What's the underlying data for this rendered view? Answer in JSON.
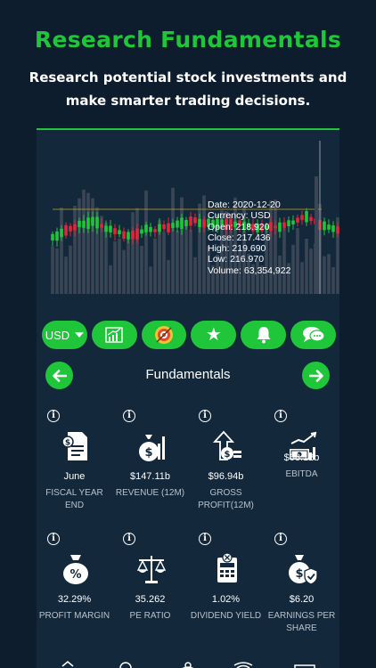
{
  "promo": {
    "headline": "Research Fundamentals",
    "subline": "Research potential stock investments and make smarter trading decisions."
  },
  "chart_data": {
    "type": "candlestick",
    "tooltip": {
      "date": "Date: 2020-12-20",
      "currency": "Currency: USD",
      "open": "Open: 218.920",
      "close": "Close: 217.436",
      "high": "High: 219.690",
      "low": "Low: 216.970",
      "volume": "Volume: 63,354,922"
    },
    "colors": {
      "up": "#1fc63a",
      "down": "#e0263a",
      "volume": "#3a4656",
      "crosshair": "#c9a227"
    }
  },
  "toolbar": {
    "currency": "USD",
    "icons": [
      "chart-growth-icon",
      "target-icon",
      "star-icon",
      "bell-icon",
      "chat-icon"
    ]
  },
  "fundamentals": {
    "title": "Fundamentals",
    "items": [
      {
        "value": "June",
        "label": "FISCAL YEAR END",
        "icon": "document-icon"
      },
      {
        "value": "$147.11b",
        "label": "REVENUE (12M)",
        "icon": "money-bag-icon"
      },
      {
        "value": "$96.94b",
        "label": "GROSS PROFIT(12M)",
        "icon": "profit-icon"
      },
      {
        "value": "$68.12b",
        "label": "EBITDA",
        "icon": "cash-stack-icon"
      },
      {
        "value": "32.29%",
        "label": "PROFIT MARGIN",
        "icon": "percent-bag-icon"
      },
      {
        "value": "35.262",
        "label": "PE RATIO",
        "icon": "scale-icon"
      },
      {
        "value": "1.02%",
        "label": "DIVIDEND YIELD",
        "icon": "calculator-icon"
      },
      {
        "value": "$6.20",
        "label": "EARNINGS PER SHARE",
        "icon": "dollar-shield-icon"
      }
    ]
  }
}
